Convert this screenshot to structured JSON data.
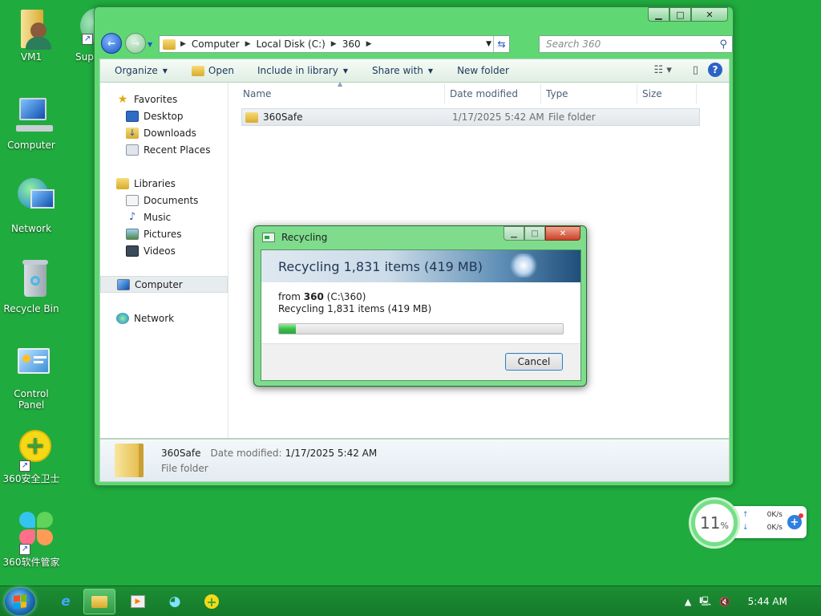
{
  "desktop": {
    "icons": [
      {
        "label": "VM1"
      },
      {
        "label": "Super"
      },
      {
        "label": "Computer"
      },
      {
        "label": "Network"
      },
      {
        "label": "Recycle Bin"
      },
      {
        "label": "Control Panel"
      },
      {
        "label": "360安全卫士"
      },
      {
        "label": "360软件管家"
      }
    ]
  },
  "explorer": {
    "breadcrumb": [
      "Computer",
      "Local Disk (C:)",
      "360"
    ],
    "search_placeholder": "Search 360",
    "toolbar": {
      "organize": "Organize",
      "open": "Open",
      "include_in_library": "Include in library",
      "share_with": "Share with",
      "new_folder": "New folder"
    },
    "nav": {
      "favorites": "Favorites",
      "desktop": "Desktop",
      "downloads": "Downloads",
      "recent_places": "Recent Places",
      "libraries": "Libraries",
      "documents": "Documents",
      "music": "Music",
      "pictures": "Pictures",
      "videos": "Videos",
      "computer": "Computer",
      "network": "Network"
    },
    "columns": {
      "name": "Name",
      "date_modified": "Date modified",
      "type": "Type",
      "size": "Size"
    },
    "files": [
      {
        "name": "360Safe",
        "date_modified": "1/17/2025 5:42 AM",
        "type": "File folder",
        "size": ""
      }
    ],
    "details": {
      "name": "360Safe",
      "date_label": "Date modified:",
      "date_value": "1/17/2025 5:42 AM",
      "type": "File folder"
    }
  },
  "dialog": {
    "title": "Recycling",
    "heading": "Recycling 1,831 items (419 MB)",
    "from_label": "from",
    "from_name": "360",
    "from_path": "(C:\\360)",
    "status": "Recycling 1,831 items (419 MB)",
    "progress_fraction": 0.06,
    "cancel_label": "Cancel"
  },
  "net_widget": {
    "percent": "11",
    "percent_sign": "%",
    "up_speed": "0K/s",
    "down_speed": "0K/s"
  },
  "taskbar": {
    "time": "5:44 AM"
  },
  "colors": {
    "desktop_bg": "#20ab3e",
    "window_frame": "#5fd874",
    "progress_green": "#38c04a"
  }
}
